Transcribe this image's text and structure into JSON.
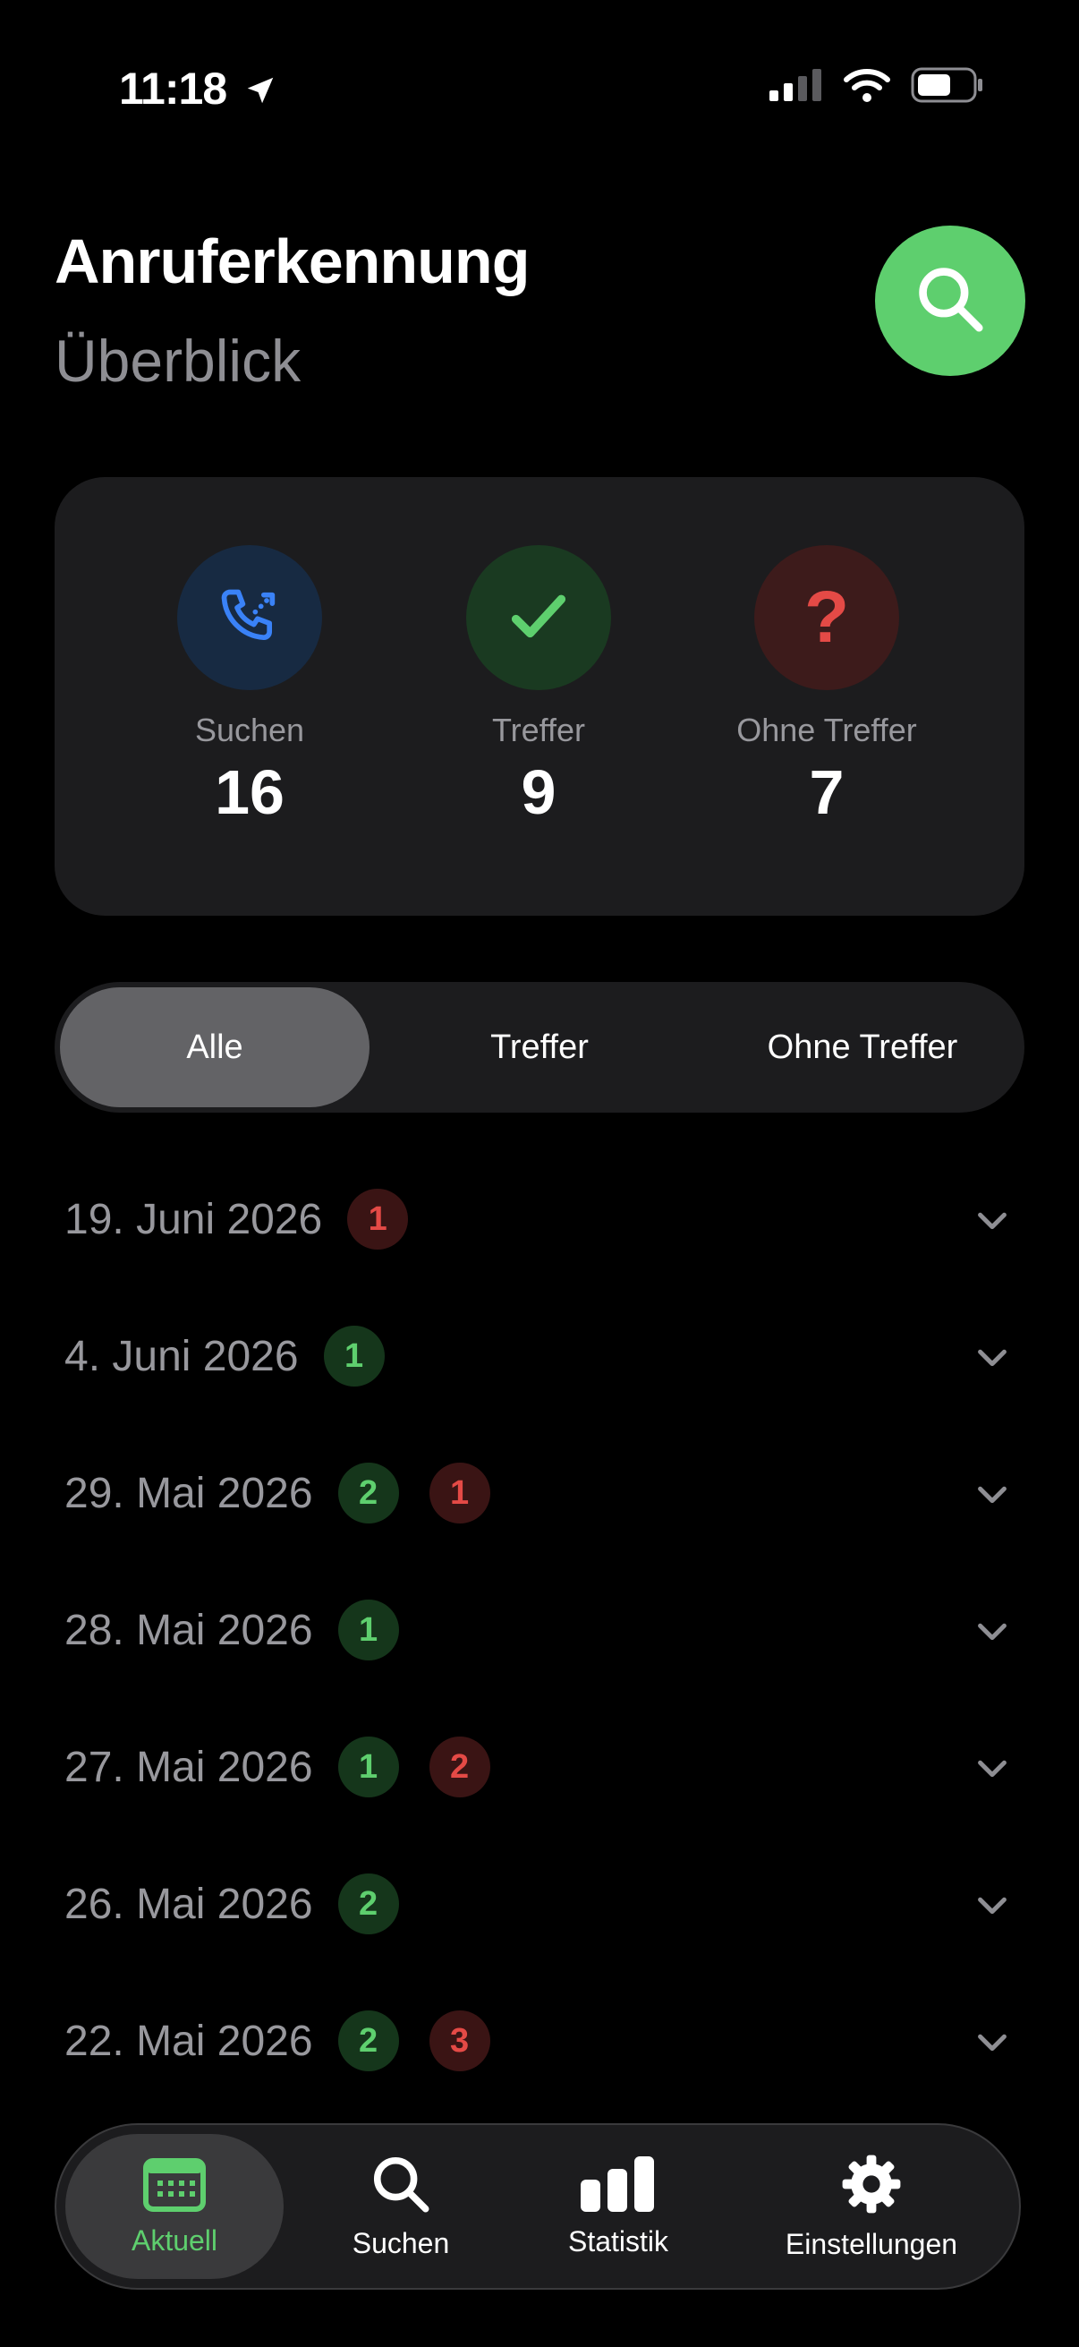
{
  "status_bar": {
    "time": "11:18"
  },
  "header": {
    "title": "Anruferkennung",
    "subtitle": "Überblick"
  },
  "stats": [
    {
      "label": "Suchen",
      "value": "16",
      "icon": "phone-search-icon",
      "color": "#3a82f7"
    },
    {
      "label": "Treffer",
      "value": "9",
      "icon": "checkmark-icon",
      "color": "#5ecf6e"
    },
    {
      "label": "Ohne Treffer",
      "value": "7",
      "icon": "question-mark-icon",
      "color": "#e44a46"
    }
  ],
  "filter": {
    "options": [
      "Alle",
      "Treffer",
      "Ohne Treffer"
    ],
    "selected": "Alle"
  },
  "dates": [
    {
      "date": "19. Juni 2026",
      "hits": "",
      "misses": "1"
    },
    {
      "date": "4. Juni 2026",
      "hits": "1",
      "misses": ""
    },
    {
      "date": "29. Mai 2026",
      "hits": "2",
      "misses": "1"
    },
    {
      "date": "28. Mai 2026",
      "hits": "1",
      "misses": ""
    },
    {
      "date": "27. Mai 2026",
      "hits": "1",
      "misses": "2"
    },
    {
      "date": "26. Mai 2026",
      "hits": "2",
      "misses": ""
    },
    {
      "date": "22. Mai 2026",
      "hits": "2",
      "misses": "3"
    }
  ],
  "tabs": [
    {
      "label": "Aktuell",
      "icon": "calendar-icon",
      "active": true
    },
    {
      "label": "Suchen",
      "icon": "search-icon",
      "active": false
    },
    {
      "label": "Statistik",
      "icon": "bar-chart-icon",
      "active": false
    },
    {
      "label": "Einstellungen",
      "icon": "gear-icon",
      "active": false
    }
  ],
  "colors": {
    "accent": "#5ecf6e",
    "miss": "#e44a46",
    "card": "#1c1c1e"
  }
}
